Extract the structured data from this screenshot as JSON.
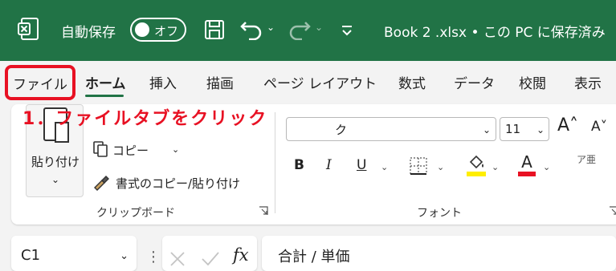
{
  "titlebar": {
    "logo_icon": "excel-logo-icon",
    "autosave_label": "自動保存",
    "toggle_label": "オフ",
    "save_icon": "save-icon",
    "undo_icon": "undo-icon",
    "redo_icon": "redo-icon",
    "dropdown_glyph": "⌄",
    "qat_icon": "customize-quick-access-icon",
    "title": "Book 2 .xlsx • この PC に保存済み"
  },
  "tabs": {
    "file": "ファイル",
    "home": "ホーム",
    "insert": "挿入",
    "draw": "描画",
    "page_layout": "ページ レイアウト",
    "formulas": "数式",
    "data": "データ",
    "review": "校閲",
    "view": "表示"
  },
  "annotation": "1．ファイルタブをクリック",
  "clipboard": {
    "paste_label": "貼り付け",
    "copy_label": "コピー",
    "format_painter_label": "書式のコピー/貼り付け",
    "group_label": "クリップボード",
    "dropdown_glyph": "⌄"
  },
  "font": {
    "name_value": "ク",
    "size_value": "11",
    "grow_label": "A˄",
    "shrink_label": "A˅",
    "bold": "B",
    "italic": "I",
    "underline": "U",
    "dropdown_glyph": "⌄",
    "furigana": "ア亜",
    "group_label": "フォント",
    "fill_color": "#ffee00",
    "font_color": "#e81123"
  },
  "formula_bar": {
    "name_box_value": "C1",
    "dropdown_glyph": "⌄",
    "more_glyph": "⋮",
    "fx_label": "fx",
    "formula_value": "合計 / 単価"
  },
  "colors": {
    "brand_green": "#217346",
    "highlight_red": "#e81123"
  }
}
